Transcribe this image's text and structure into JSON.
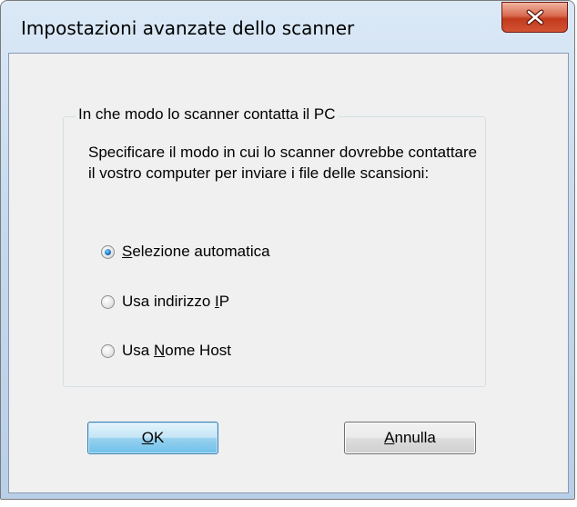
{
  "window": {
    "title": "Impostazioni avanzate dello scanner",
    "close_icon": "close-icon"
  },
  "group": {
    "legend": "In che modo lo scanner contatta il PC",
    "description": "Specificare il modo in cui lo scanner dovrebbe contattare il vostro computer per inviare i file delle scansioni:",
    "options": [
      {
        "prefix": "",
        "accel": "S",
        "suffix": "elezione automatica",
        "selected": true
      },
      {
        "prefix": "Usa indirizzo ",
        "accel": "I",
        "suffix": "P",
        "selected": false
      },
      {
        "prefix": "Usa ",
        "accel": "N",
        "suffix": "ome Host",
        "selected": false
      }
    ]
  },
  "buttons": {
    "ok": {
      "accel": "O",
      "suffix": "K"
    },
    "cancel": {
      "accel": "A",
      "suffix": "nnulla"
    }
  },
  "colors": {
    "close_button": "#c23a1d",
    "default_button_border": "#3c7fb1",
    "radio_selected": "#1a6fc0"
  }
}
